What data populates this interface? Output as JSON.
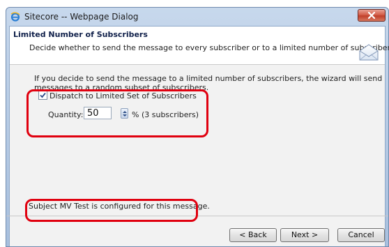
{
  "window": {
    "title": "Sitecore -- Webpage Dialog",
    "icon": "ie-icon",
    "close_icon": "close-icon"
  },
  "header": {
    "title": "Limited Number of Subscribers",
    "description": "Decide whether to send the message to every subscriber or to a limited number of subscribers.",
    "icon": "envelope-icon"
  },
  "body": {
    "intro": "If you decide to send the message to a limited number of subscribers, the wizard will send messages to a random subset of subscribers.",
    "dispatch_checkbox": {
      "label": "Dispatch to Limited Set of Subscribers",
      "checked": true
    },
    "quantity": {
      "label": "Quantity:",
      "value": "50",
      "suffix": "% (3 subscribers)"
    },
    "status_message": "Subject MV Test is configured for this message."
  },
  "footer": {
    "back_label": "< Back",
    "next_label": "Next >",
    "cancel_label": "Cancel"
  },
  "colors": {
    "highlight": "#e0000f",
    "title_bar": "#b9cde6"
  }
}
